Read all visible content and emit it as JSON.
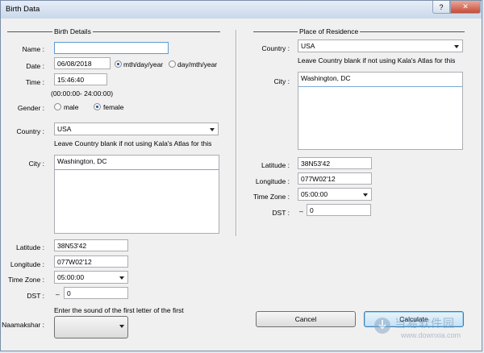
{
  "window": {
    "title": "Birth Data",
    "help_label": "?",
    "close_label": "✕"
  },
  "birth": {
    "group_title": "Birth Details",
    "name_label": "Name :",
    "name_value": "",
    "date_label": "Date :",
    "date_value": "06/08/2018",
    "date_format_1": "mth/day/year",
    "date_format_2": "day/mth/year",
    "time_label": "Time :",
    "time_value": "15:46:40",
    "time_hint": "(00:00:00- 24:00:00)",
    "gender_label": "Gender :",
    "gender_male": "male",
    "gender_female": "female",
    "country_label": "Country :",
    "country_value": "USA",
    "country_hint": "Leave Country blank if not using Kala's Atlas for this",
    "city_label": "City :",
    "city_value": "Washington, DC",
    "latitude_label": "Latitude :",
    "latitude_value": "38N53'42",
    "longitude_label": "Longitude :",
    "longitude_value": "077W02'12",
    "timezone_label": "Time Zone :",
    "timezone_value": "05:00:00",
    "dst_label": "DST :",
    "dst_sign": "–",
    "dst_value": "0",
    "naamakshar_hint": "Enter the sound of the first letter of the first",
    "naamakshar_label": "Naamakshar :"
  },
  "residence": {
    "group_title": "Place of Residence",
    "country_label": "Country :",
    "country_value": "USA",
    "country_hint": "Leave Country blank if not using Kala's Atlas for this",
    "city_label": "City :",
    "city_value": "Washington, DC",
    "latitude_label": "Latitude :",
    "latitude_value": "38N53'42",
    "longitude_label": "Longitude :",
    "longitude_value": "077W02'12",
    "timezone_label": "Time Zone :",
    "timezone_value": "05:00:00",
    "dst_label": "DST :",
    "dst_sign": "–",
    "dst_value": "0"
  },
  "buttons": {
    "cancel": "Cancel",
    "calculate": "Calculate"
  },
  "watermark": {
    "text": "当易软件园",
    "url": "www.downxia.com"
  }
}
